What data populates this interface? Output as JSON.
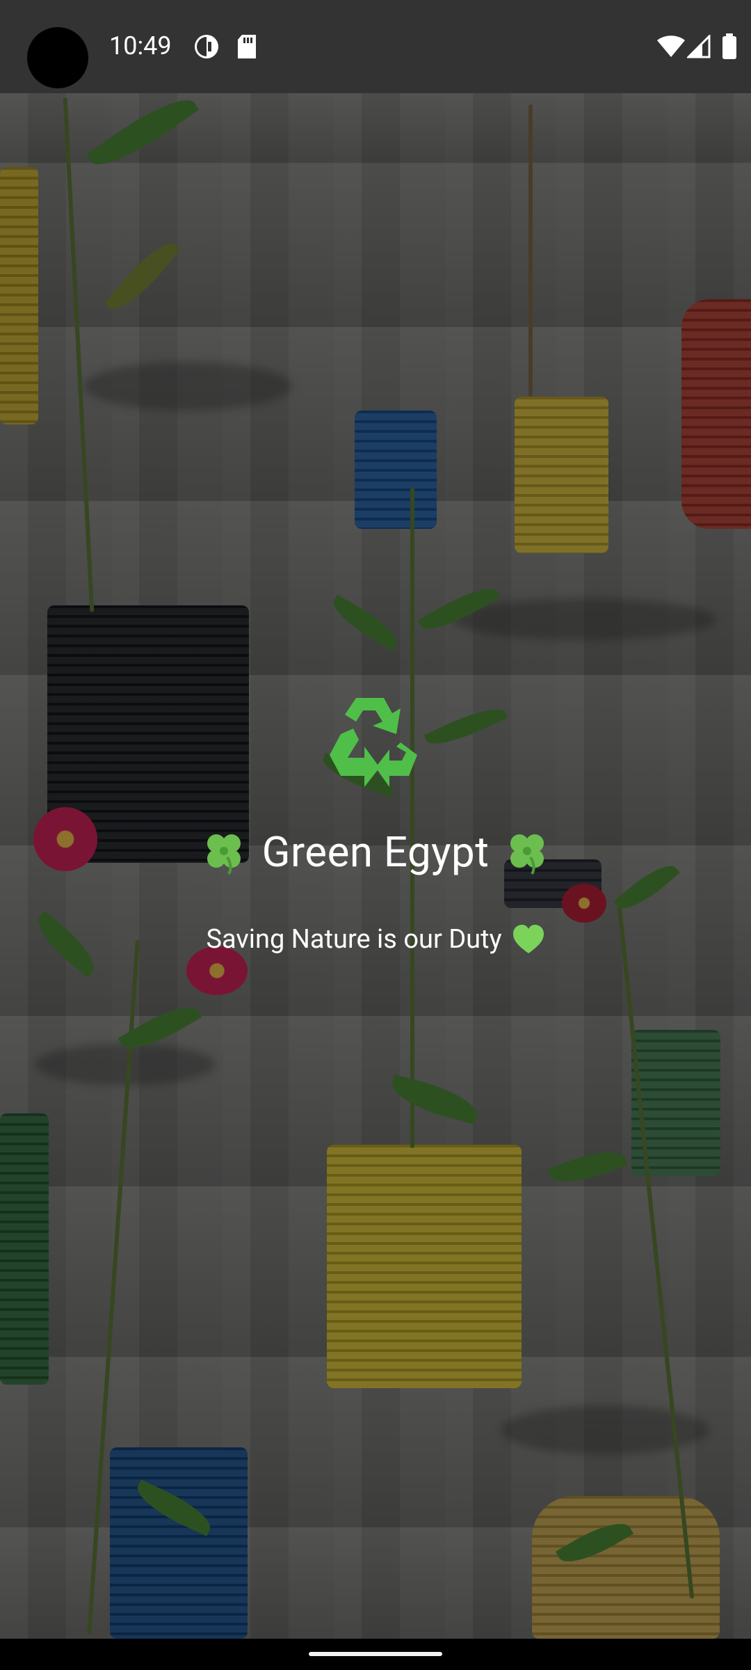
{
  "status_bar": {
    "time": "10:49",
    "icons": [
      "vpn-icon",
      "sd-card-icon",
      "wifi-icon",
      "signal-icon",
      "battery-icon"
    ]
  },
  "splash": {
    "logo_icon": "recycle-icon",
    "title": "Green Egypt",
    "title_decoration_icon": "four-leaf-clover-icon",
    "tagline": "Saving Nature is our Duty",
    "tagline_icon": "green-heart-icon",
    "accent_color": "#4fbf4a"
  },
  "navigation": {
    "handle": "home-gesture-handle"
  }
}
